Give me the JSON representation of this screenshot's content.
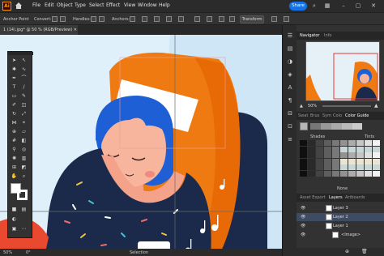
{
  "app": {
    "logo": "Ai"
  },
  "menu": [
    "File",
    "Edit",
    "Object",
    "Type",
    "Select",
    "Effect",
    "View",
    "Window",
    "Help"
  ],
  "share_label": "Share",
  "control_bar": {
    "anchor_point": "Anchor Point",
    "convert": "Convert:",
    "handles": "Handles:",
    "anchors": "Anchors:",
    "transform": "Transform"
  },
  "doc_tab": "1 (14).jpg* @ 50 % (RGB/Preview)",
  "status": {
    "zoom": "50%",
    "rotate": "0°",
    "tool": "Selection"
  },
  "navigator": {
    "tabs": [
      "Navigator",
      "Info"
    ],
    "zoom": "50%"
  },
  "swatches": {
    "tabs": [
      "Swat",
      "Brus",
      "Sym",
      "Colo",
      "Color Guide"
    ],
    "shades": "Shades",
    "tints": "Tints",
    "none_label": "None"
  },
  "layers": {
    "tabs": [
      "Asset Export",
      "Layers",
      "Artboards"
    ],
    "rows": [
      "Layer 3",
      "Layer 2",
      "Layer 1",
      "<Image>"
    ]
  },
  "colors": {
    "accent": "#1473e6",
    "ui_dark": "#323232",
    "hair": "#1e5fd6",
    "chair": "#f07a12",
    "shirt": "#1b2a4a"
  }
}
